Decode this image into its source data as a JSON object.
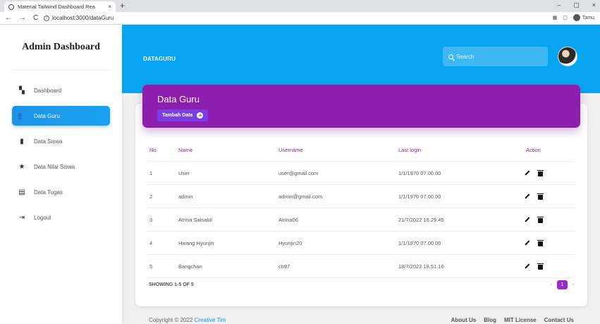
{
  "browser": {
    "tab_title": "Material Tailwind Dashboard Rea",
    "tab_close": "×",
    "new_tab": "+",
    "url": "localhost:3000/dataGuru",
    "profile": "Tamu",
    "window_min": "–",
    "window_max": "▢",
    "window_close": "×"
  },
  "sidebar": {
    "brand": "Admin Dashboard",
    "items": [
      {
        "label": "Dashboard",
        "icon": "dashboard-icon"
      },
      {
        "label": "Data Guru",
        "icon": "people-icon",
        "active": true
      },
      {
        "label": "Data Siswa",
        "icon": "id-card-icon"
      },
      {
        "label": "Data Nilai Siswa",
        "icon": "star-icon"
      },
      {
        "label": "Data Tugas",
        "icon": "document-icon"
      },
      {
        "label": "Logout",
        "icon": "logout-icon"
      }
    ]
  },
  "header": {
    "page": "DATAGURU",
    "search_placeholder": "Search"
  },
  "banner": {
    "title": "Data Guru",
    "add_button": "Tambah Data"
  },
  "table": {
    "headers": {
      "no": "No.",
      "name": "Name",
      "username": "Username",
      "last_login": "Last login",
      "action": "Action"
    },
    "rows": [
      {
        "no": "1",
        "name": "User",
        "username": "user@gmail.com",
        "last_login": "1/1/1970 07.00.00"
      },
      {
        "no": "2",
        "name": "admin",
        "username": "admin@gmail.com",
        "last_login": "1/1/1970 07.00.00"
      },
      {
        "no": "3",
        "name": "Atrina Salsabil",
        "username": "Atrina06",
        "last_login": "21/7/2022 16.29.45"
      },
      {
        "no": "4",
        "name": "Hwang Hyunjin",
        "username": "Hyunjin20",
        "last_login": "1/1/1970 07.00.00"
      },
      {
        "no": "5",
        "name": "Bangchan",
        "username": "cb97",
        "last_login": "18/7/2022 18.51.16"
      }
    ],
    "showing": "SHOWING 1-5 OF 5",
    "page": "1"
  },
  "footer": {
    "copyright": "Copyright © 2022",
    "brand_link": "Creative Tim",
    "links": [
      "About Us",
      "Blog",
      "MIT License",
      "Contact Us"
    ]
  },
  "colors": {
    "primary": "#07a4f2",
    "banner": "#8e1ead",
    "active": "#1d93e8"
  }
}
